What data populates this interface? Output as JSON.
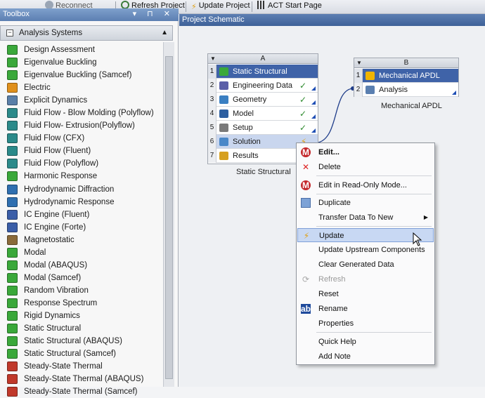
{
  "toolbar": {
    "reconnect_label": "Reconnect",
    "refresh_label": "Refresh Project",
    "update_label": "Update Project",
    "act_label": "ACT Start Page"
  },
  "toolbox": {
    "title": "Toolbox",
    "controls": "▾ ⊓ ✕",
    "section_label": "Analysis Systems",
    "items": [
      {
        "label": "Design Assessment",
        "color": "#3aa83a"
      },
      {
        "label": "Eigenvalue Buckling",
        "color": "#3aa83a"
      },
      {
        "label": "Eigenvalue Buckling (Samcef)",
        "color": "#3aa83a"
      },
      {
        "label": "Electric",
        "color": "#e0901c"
      },
      {
        "label": "Explicit Dynamics",
        "color": "#5a7fa8"
      },
      {
        "label": "Fluid Flow - Blow Molding (Polyflow)",
        "color": "#2b8a8a"
      },
      {
        "label": "Fluid Flow- Extrusion(Polyflow)",
        "color": "#2b8a8a"
      },
      {
        "label": "Fluid Flow (CFX)",
        "color": "#2b8a8a"
      },
      {
        "label": "Fluid Flow (Fluent)",
        "color": "#2b8a8a"
      },
      {
        "label": "Fluid Flow (Polyflow)",
        "color": "#2b8a8a"
      },
      {
        "label": "Harmonic Response",
        "color": "#3aa83a"
      },
      {
        "label": "Hydrodynamic Diffraction",
        "color": "#2f6fb0"
      },
      {
        "label": "Hydrodynamic Response",
        "color": "#2f6fb0"
      },
      {
        "label": "IC Engine (Fluent)",
        "color": "#3b5ea8"
      },
      {
        "label": "IC Engine (Forte)",
        "color": "#3b5ea8"
      },
      {
        "label": "Magnetostatic",
        "color": "#8a6a3a"
      },
      {
        "label": "Modal",
        "color": "#3aa83a"
      },
      {
        "label": "Modal (ABAQUS)",
        "color": "#3aa83a"
      },
      {
        "label": "Modal (Samcef)",
        "color": "#3aa83a"
      },
      {
        "label": "Random Vibration",
        "color": "#3aa83a"
      },
      {
        "label": "Response Spectrum",
        "color": "#3aa83a"
      },
      {
        "label": "Rigid Dynamics",
        "color": "#3aa83a"
      },
      {
        "label": "Static Structural",
        "color": "#3aa83a"
      },
      {
        "label": "Static Structural (ABAQUS)",
        "color": "#3aa83a"
      },
      {
        "label": "Static Structural (Samcef)",
        "color": "#3aa83a"
      },
      {
        "label": "Steady-State Thermal",
        "color": "#c0392b"
      },
      {
        "label": "Steady-State Thermal (ABAQUS)",
        "color": "#c0392b"
      },
      {
        "label": "Steady-State Thermal (Samcef)",
        "color": "#c0392b"
      }
    ]
  },
  "schematic": {
    "title": "Project Schematic",
    "system_a": {
      "column": "A",
      "caption": "Static Structural",
      "cells": [
        {
          "num": "1",
          "label": "Static Structural",
          "status": ""
        },
        {
          "num": "2",
          "label": "Engineering Data",
          "status": "✓"
        },
        {
          "num": "3",
          "label": "Geometry",
          "status": "✓"
        },
        {
          "num": "4",
          "label": "Model",
          "status": "✓"
        },
        {
          "num": "5",
          "label": "Setup",
          "status": "✓"
        },
        {
          "num": "6",
          "label": "Solution",
          "status": "⚡"
        },
        {
          "num": "7",
          "label": "Results",
          "status": ""
        }
      ]
    },
    "system_b": {
      "column": "B",
      "caption": "Mechanical APDL",
      "cells": [
        {
          "num": "1",
          "label": "Mechanical APDL",
          "status": ""
        },
        {
          "num": "2",
          "label": "Analysis",
          "status": ""
        }
      ]
    }
  },
  "context_menu": {
    "items": [
      {
        "label": "Edit..."
      },
      {
        "label": "Delete"
      },
      {
        "label": "Edit in Read-Only Mode..."
      },
      {
        "label": "Duplicate"
      },
      {
        "label": "Transfer Data To New"
      },
      {
        "label": "Update"
      },
      {
        "label": "Update Upstream Components"
      },
      {
        "label": "Clear Generated Data"
      },
      {
        "label": "Refresh"
      },
      {
        "label": "Reset"
      },
      {
        "label": "Rename"
      },
      {
        "label": "Properties"
      },
      {
        "label": "Quick Help"
      },
      {
        "label": "Add Note"
      }
    ]
  },
  "colors": {
    "accent": "#3f63a8",
    "panel_title": "#5c7fb2",
    "check": "#2e8b2e"
  }
}
